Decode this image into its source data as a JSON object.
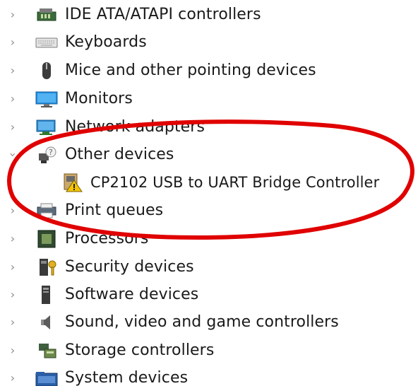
{
  "tree": {
    "items": [
      {
        "label": "IDE ATA/ATAPI controllers",
        "icon": "ide-controller-icon",
        "expanded": false
      },
      {
        "label": "Keyboards",
        "icon": "keyboard-icon",
        "expanded": false
      },
      {
        "label": "Mice and other pointing devices",
        "icon": "mouse-icon",
        "expanded": false
      },
      {
        "label": "Monitors",
        "icon": "monitor-icon",
        "expanded": false
      },
      {
        "label": "Network adapters",
        "icon": "network-adapter-icon",
        "expanded": false
      },
      {
        "label": "Other devices",
        "icon": "unknown-device-icon",
        "expanded": true,
        "children": [
          {
            "label": "CP2102 USB to UART Bridge Controller",
            "icon": "warning-device-icon"
          }
        ]
      },
      {
        "label": "Print queues",
        "icon": "printer-icon",
        "expanded": false
      },
      {
        "label": "Processors",
        "icon": "processor-icon",
        "expanded": false
      },
      {
        "label": "Security devices",
        "icon": "security-device-icon",
        "expanded": false
      },
      {
        "label": "Software devices",
        "icon": "software-device-icon",
        "expanded": false
      },
      {
        "label": "Sound, video and game controllers",
        "icon": "speaker-icon",
        "expanded": false
      },
      {
        "label": "Storage controllers",
        "icon": "storage-controller-icon",
        "expanded": false
      },
      {
        "label": "System devices",
        "icon": "system-devices-icon",
        "expanded": false
      }
    ]
  },
  "annotation": {
    "shape": "ellipse",
    "color": "#e00000",
    "highlights": "Other devices"
  }
}
